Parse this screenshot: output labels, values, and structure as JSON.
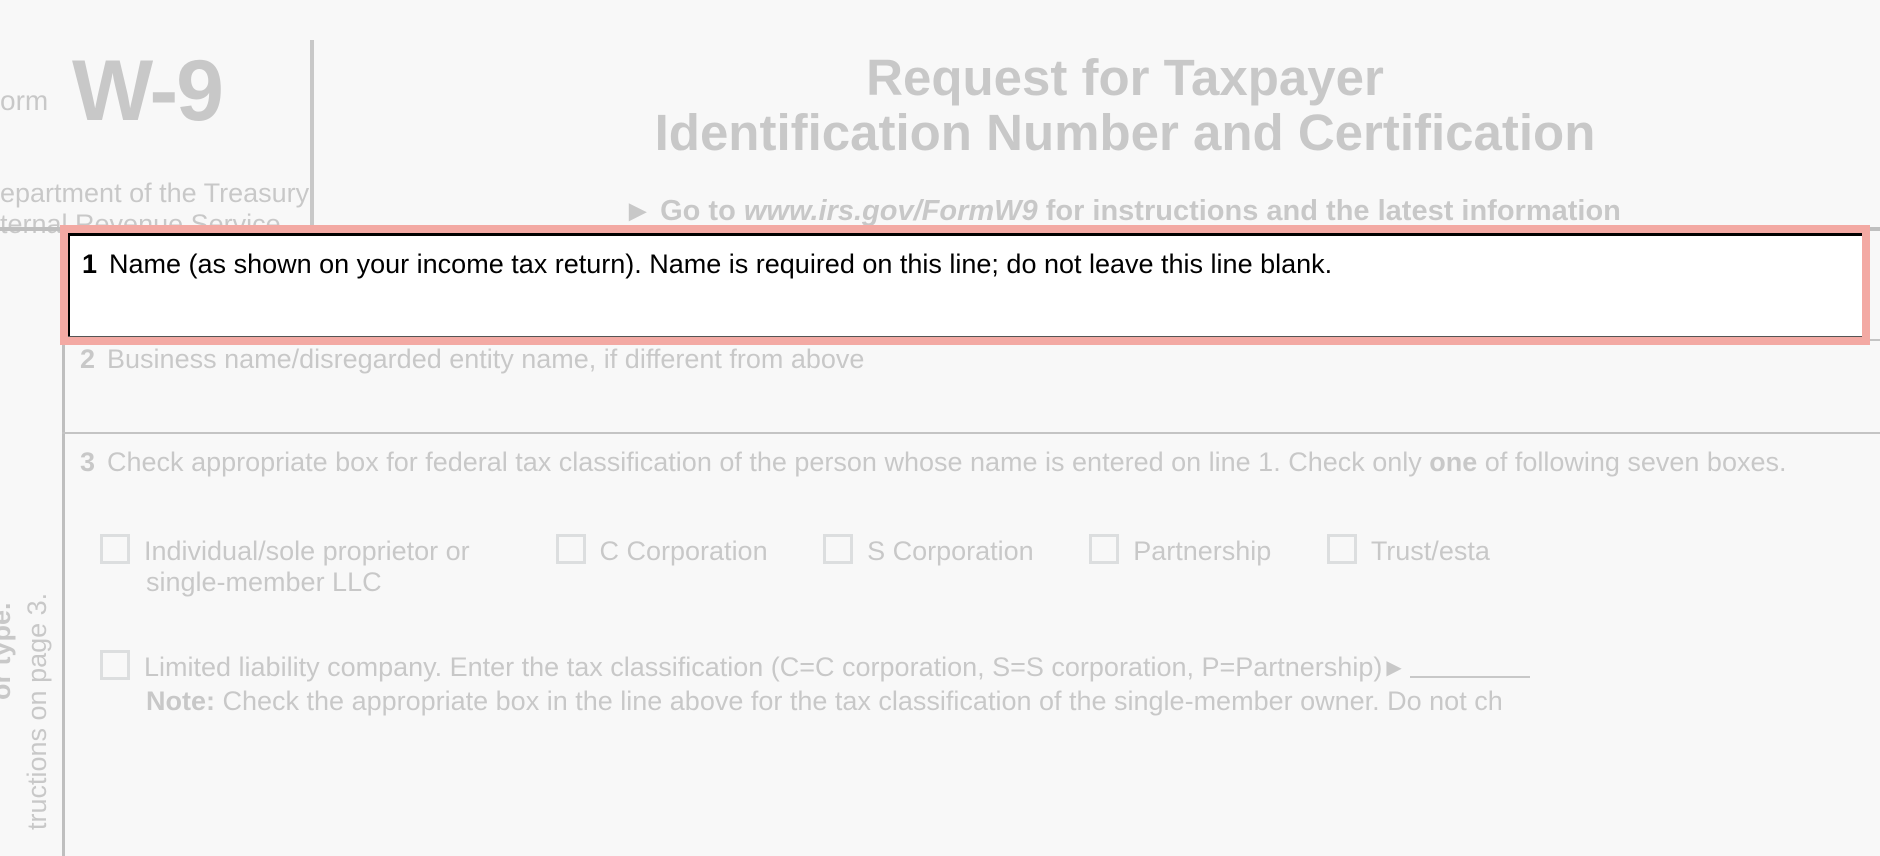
{
  "header": {
    "form_word": "orm",
    "form_id": "W-9",
    "dept_line1": "epartment of the Treasury",
    "dept_line2": "ternal Revenue Service",
    "title_line1": "Request for Taxpayer",
    "title_line2": "Identification Number and Certification",
    "goto_prefix": "Go to ",
    "goto_url": "www.irs.gov/FormW9",
    "goto_suffix": " for instructions and the latest information"
  },
  "sidebar": {
    "text_a": "or type.",
    "text_b": "tructions on page 3."
  },
  "line1": {
    "num": "1",
    "text": "Name (as shown on your income tax return). Name is required on this line; do not leave this line blank."
  },
  "line2": {
    "num": "2",
    "text": "Business name/disregarded entity name, if different from above"
  },
  "line3": {
    "num": "3",
    "text_a": "Check appropriate box for federal tax classification of the person whose name is entered on line 1. Check only ",
    "one": "one",
    "text_b": " of following seven boxes."
  },
  "checks": {
    "ind_a": "Individual/sole proprietor or",
    "ind_b": "single-member LLC",
    "ccorp": "C Corporation",
    "scorp": "S Corporation",
    "partnership": "Partnership",
    "trust": "Trust/esta"
  },
  "llc": {
    "line_a": "Limited liability company. Enter the tax classification (C=C corporation, S=S corporation, P=Partnership)",
    "note_label": "Note:",
    "note_text": " Check the appropriate box in the line above for the tax classification of the single-member owner.  Do not ch"
  }
}
